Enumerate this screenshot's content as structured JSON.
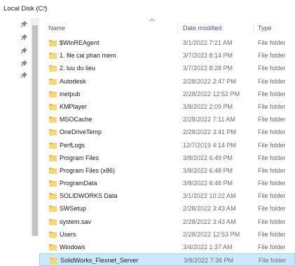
{
  "address": {
    "location": "Local Disk (C:)",
    "chevron": "›"
  },
  "pins": [
    "📌",
    "📌",
    "📌",
    "📌",
    "📌"
  ],
  "columns": {
    "name": "Name",
    "date_modified": "Date modified",
    "type": "Type"
  },
  "icons": {
    "folder": "folder-icon",
    "pin": "pin-icon",
    "sort_arrow": "sort-ascending-icon"
  },
  "colors": {
    "folder": "#f8d775",
    "folder_dark": "#e8b84a",
    "selection": "#cce8ff",
    "header_text": "#4c607a"
  },
  "files": [
    {
      "name": "$WinREAgent",
      "date": "3/1/2022 7:21 AM",
      "type": "File folder"
    },
    {
      "name": "1. file cai phan mem",
      "date": "3/7/2022 8:14 PM",
      "type": "File folder"
    },
    {
      "name": "2. luu du lieu",
      "date": "3/7/2022 8:28 PM",
      "type": "File folder"
    },
    {
      "name": "Autodesk",
      "date": "2/28/2022 2:47 PM",
      "type": "File folder"
    },
    {
      "name": "inetpub",
      "date": "2/28/2022 12:52 PM",
      "type": "File folder"
    },
    {
      "name": "KMPlayer",
      "date": "3/8/2022 2:09 PM",
      "type": "File folder"
    },
    {
      "name": "MSOCache",
      "date": "2/28/2022 7:11 AM",
      "type": "File folder"
    },
    {
      "name": "OneDriveTemp",
      "date": "2/28/2022 3:41 PM",
      "type": "File folder"
    },
    {
      "name": "PerfLogs",
      "date": "12/7/2019 4:14 PM",
      "type": "File folder"
    },
    {
      "name": "Program Files",
      "date": "3/8/2022 6:49 PM",
      "type": "File folder"
    },
    {
      "name": "Program Files (x86)",
      "date": "3/8/2022 6:48 PM",
      "type": "File folder"
    },
    {
      "name": "ProgramData",
      "date": "3/8/2022 6:48 PM",
      "type": "File folder"
    },
    {
      "name": "SOLIDWORKS Data",
      "date": "3/1/2022 10:22 AM",
      "type": "File folder"
    },
    {
      "name": "SWSetup",
      "date": "2/28/2022 3:43 AM",
      "type": "File folder"
    },
    {
      "name": "system.sav",
      "date": "2/28/2022 3:43 AM",
      "type": "File folder"
    },
    {
      "name": "Users",
      "date": "2/28/2022 12:53 PM",
      "type": "File folder"
    },
    {
      "name": "Windows",
      "date": "3/4/2022 1:37 AM",
      "type": "File folder"
    },
    {
      "name": "SolidWorks_Flexnet_Server",
      "date": "3/8/2022 7:36 PM",
      "type": "File folder",
      "selected": true
    }
  ]
}
